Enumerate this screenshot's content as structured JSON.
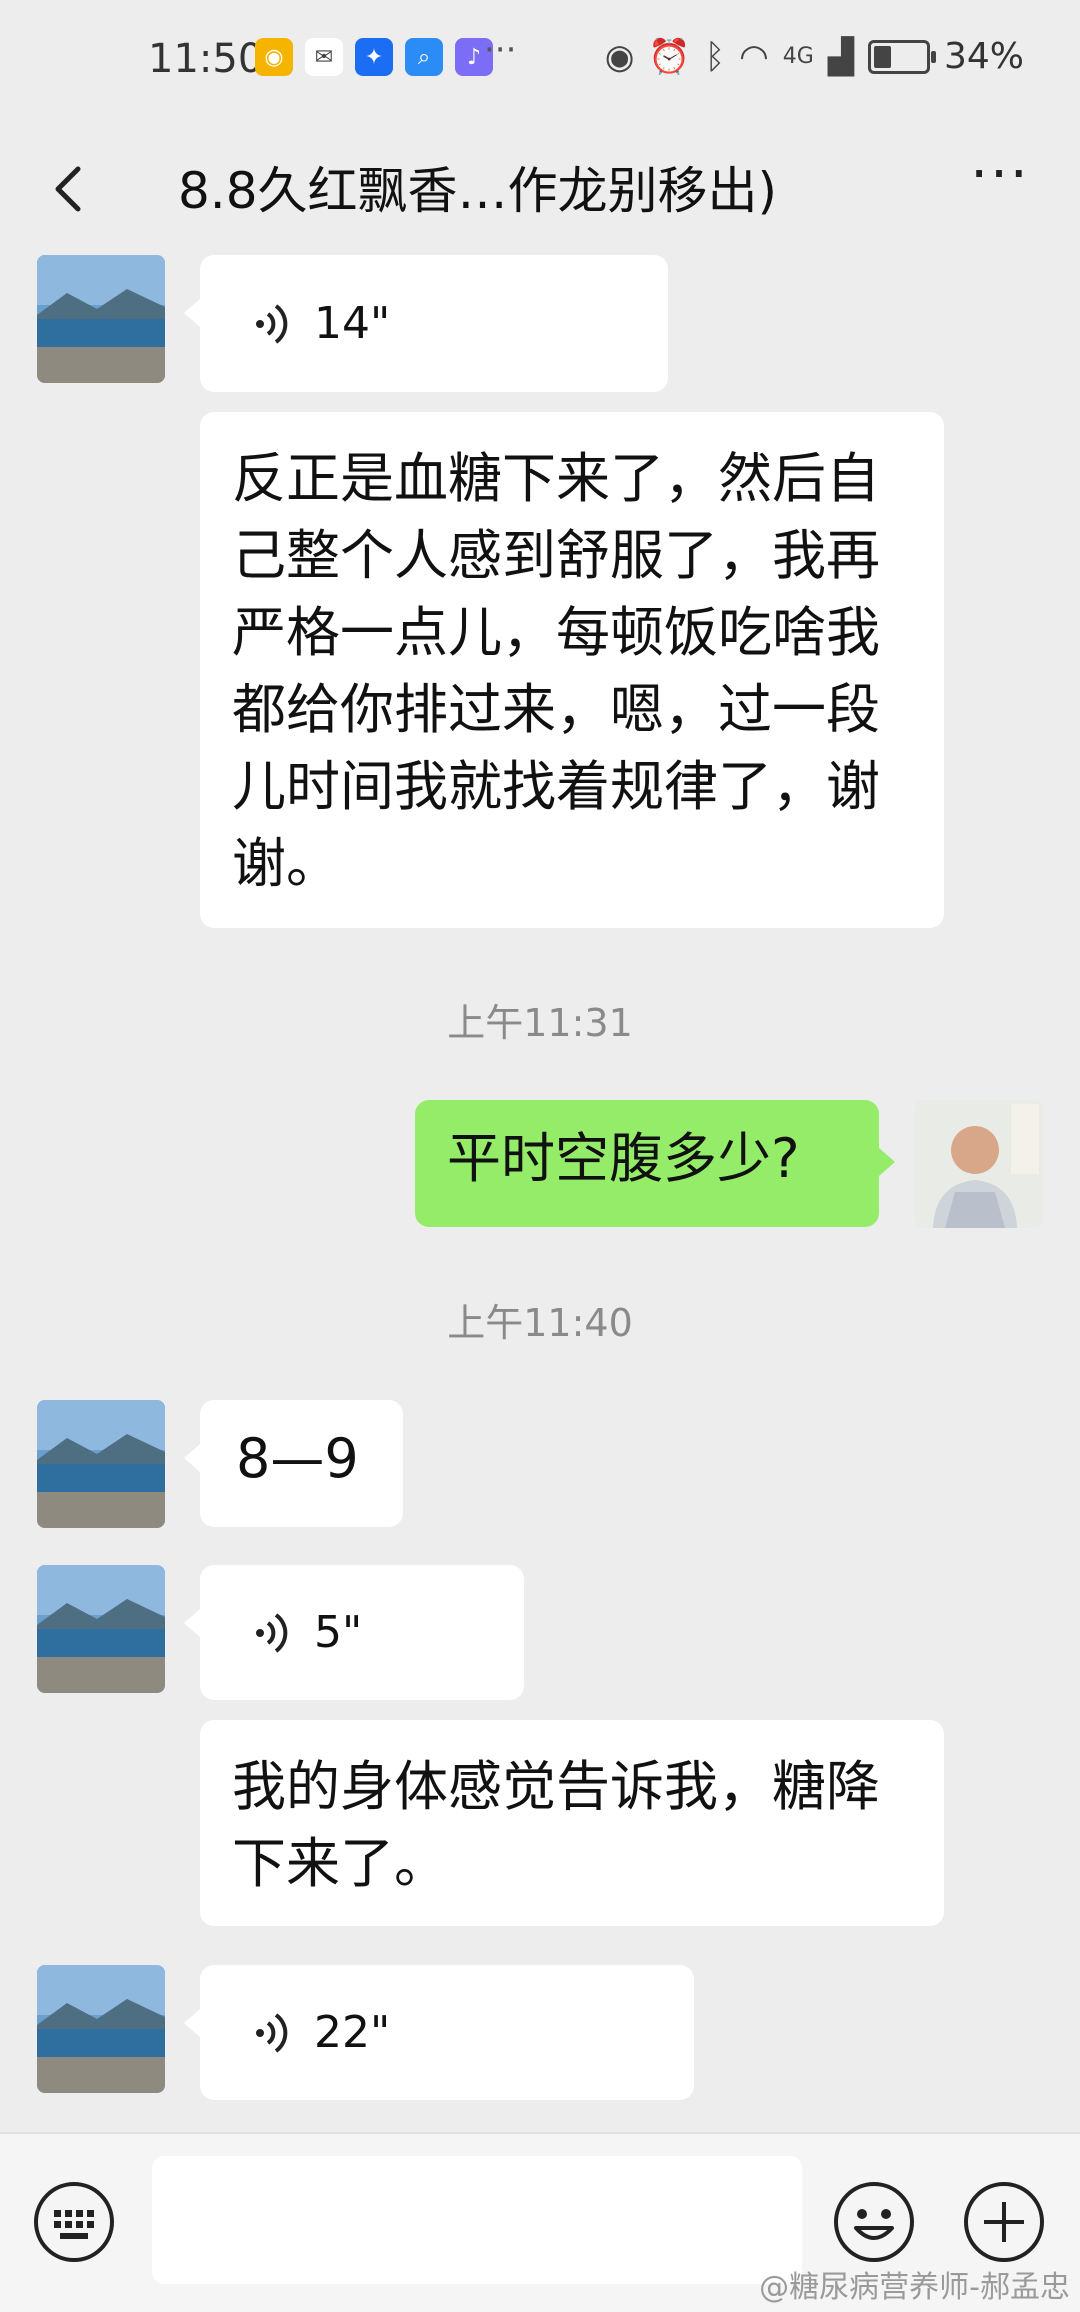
{
  "status_bar": {
    "time": "11:50",
    "app_icons": [
      "weibo-icon",
      "wechat-icon",
      "bulb-app-icon",
      "search-app-icon",
      "music-app-icon"
    ],
    "more": "···",
    "network": "4G",
    "battery": "34%",
    "battery_level": 0.34
  },
  "header": {
    "title": "8.8久红飘香…作龙别移出)",
    "more_label": "···"
  },
  "messages": [
    {
      "side": "left",
      "type": "voice",
      "duration": "14\""
    },
    {
      "side": "left",
      "type": "text",
      "text": "反正是血糖下来了，然后自己整个人感到舒服了，我再严格一点儿，每顿饭吃啥我都给你排过来，嗯，过一段儿时间我就找着规律了，谢谢。"
    },
    {
      "type": "timestamp",
      "text": "上午11:31"
    },
    {
      "side": "right",
      "type": "text",
      "text": "平时空腹多少?"
    },
    {
      "type": "timestamp",
      "text": "上午11:40"
    },
    {
      "side": "left",
      "type": "text",
      "text": "8—9"
    },
    {
      "side": "left",
      "type": "voice",
      "duration": "5\""
    },
    {
      "side": "left",
      "type": "text",
      "text": "我的身体感觉告诉我，糖降下来了。"
    },
    {
      "side": "left",
      "type": "voice",
      "duration": "22\""
    }
  ],
  "watermark": "@糖尿病营养师-郝孟忠",
  "colors": {
    "background": "#ededed",
    "self_bubble": "#95ec69",
    "other_bubble": "#ffffff",
    "timestamp_text": "#8a8a8a"
  }
}
